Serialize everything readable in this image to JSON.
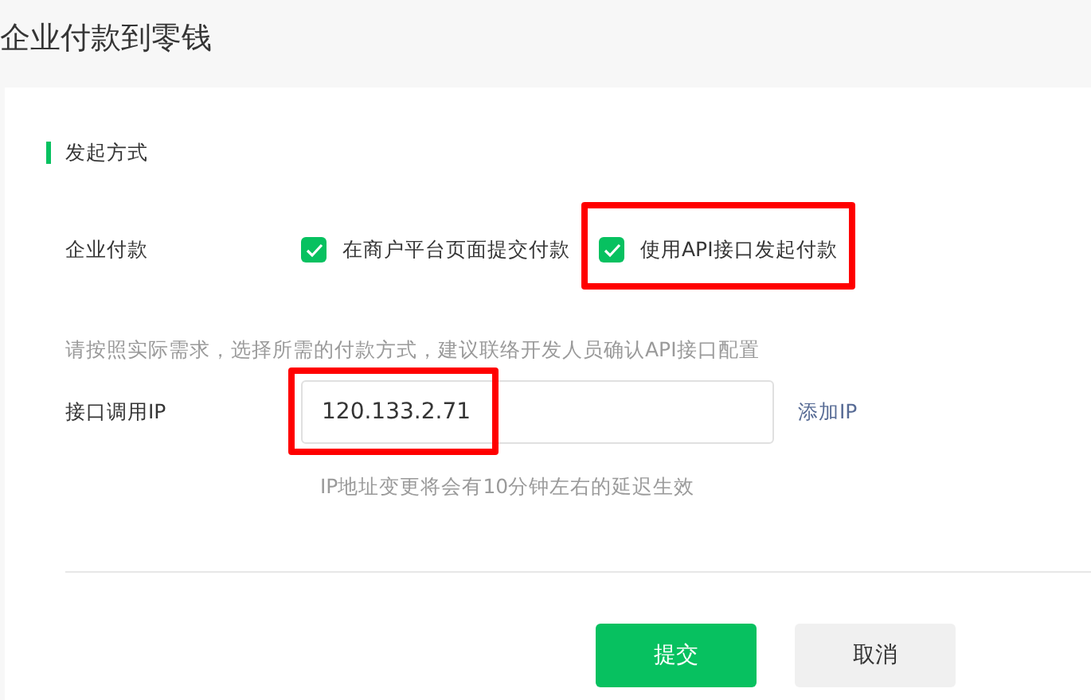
{
  "page_title": "企业付款到零钱",
  "section_title": "发起方式",
  "payment": {
    "label": "企业付款",
    "options": [
      {
        "label": "在商户平台页面提交付款",
        "checked": true,
        "highlighted": false
      },
      {
        "label": "使用API接口发起付款",
        "checked": true,
        "highlighted": true
      }
    ]
  },
  "hint": "请按照实际需求，选择所需的付款方式，建议联络开发人员确认API接口配置",
  "ip": {
    "label": "接口调用IP",
    "value": "120.133.2.71",
    "highlighted": true,
    "link": "添加IP",
    "help": "IP地址变更将会有10分钟左右的延迟生效"
  },
  "buttons": [
    {
      "label": "提交",
      "kind": "primary"
    },
    {
      "label": "取消",
      "kind": "secondary"
    }
  ]
}
